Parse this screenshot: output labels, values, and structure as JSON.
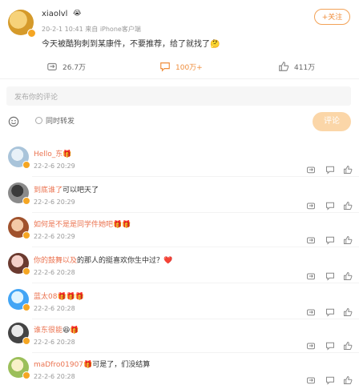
{
  "post": {
    "author": "xiaolvl",
    "author_emoji": "😭",
    "follow_label": "+关注",
    "meta": "20-2-1 10:41 来自 iPhone客户端",
    "text": "今天被酷狗刺到某康件，不要推荐，给了就找了🤔",
    "actions": {
      "repost": "26.7万",
      "comment": "100万+",
      "like": "411万"
    }
  },
  "comment_box": {
    "placeholder": "发布你的评论",
    "repost_label": "同时转发",
    "submit_label": "评论"
  },
  "comments": [
    {
      "name": "Hello_东",
      "text": "🎁",
      "time": "22-2-6 20:29"
    },
    {
      "name": "到底谁了",
      "text": "可以吧天了",
      "time": "22-2-6 20:29"
    },
    {
      "name": "如何是不是是同学件她吧",
      "text": "🎁🎁",
      "time": "22-2-6 20:29"
    },
    {
      "name": "你的鼓舞以及",
      "text": "的那人的挺喜欢你生中过？❤️",
      "time": "22-2-6 20:28"
    },
    {
      "name": "蓝太08",
      "text": "🎁🎁🎁",
      "time": "22-2-6 20:28"
    },
    {
      "name": "谁东很能",
      "text": "😆🎁",
      "time": "22-2-6 20:28"
    },
    {
      "name": "maDfro01907",
      "text": "🎁可是了，们没结算",
      "time": "22-2-6 20:28"
    }
  ],
  "colors": {
    "accent": "#ef8d3b",
    "name": "#eb7350",
    "submit_bg": "#fbd6a8"
  },
  "icons": {
    "emoji": "smiley-icon",
    "repost": "repost-icon",
    "comment": "comment-icon",
    "like": "thumbs-up-icon"
  }
}
